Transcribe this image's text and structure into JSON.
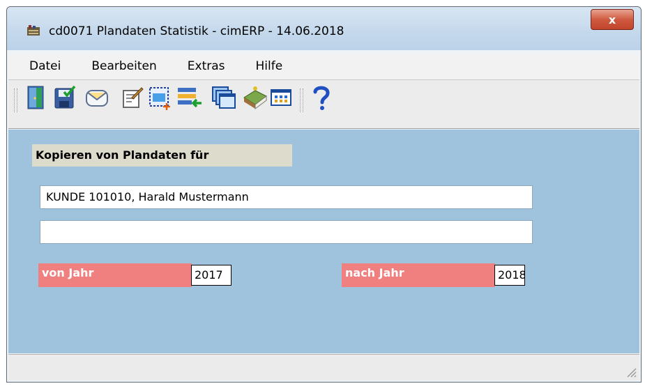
{
  "window": {
    "title": "cd0071 Plandaten Statistik - cimERP - 14.06.2018",
    "close_label": "x"
  },
  "menu": [
    {
      "label": "Datei"
    },
    {
      "label": "Bearbeiten"
    },
    {
      "label": "Extras"
    },
    {
      "label": "Hilfe"
    }
  ],
  "toolbar": [
    {
      "icon": "exit-door-icon"
    },
    {
      "icon": "save-check-icon"
    },
    {
      "icon": "envelope-icon"
    },
    {
      "icon": "edit-note-icon"
    },
    {
      "icon": "new-record-icon"
    },
    {
      "icon": "import-list-icon"
    },
    {
      "icon": "windows-icon"
    },
    {
      "icon": "book-icon"
    },
    {
      "icon": "grid-window-icon"
    },
    {
      "icon": "help-icon"
    }
  ],
  "form": {
    "heading": "Kopieren von Plandaten für",
    "customer_value": "KUNDE 101010, Harald  Mustermann",
    "second_value": "",
    "from_year_label": "von Jahr",
    "from_year_value": "2017",
    "to_year_label": "nach Jahr",
    "to_year_value": "2018"
  },
  "colors": {
    "content_bg": "#9fc3dc",
    "label_red": "#f08080",
    "heading_bg": "#dddbcc"
  }
}
